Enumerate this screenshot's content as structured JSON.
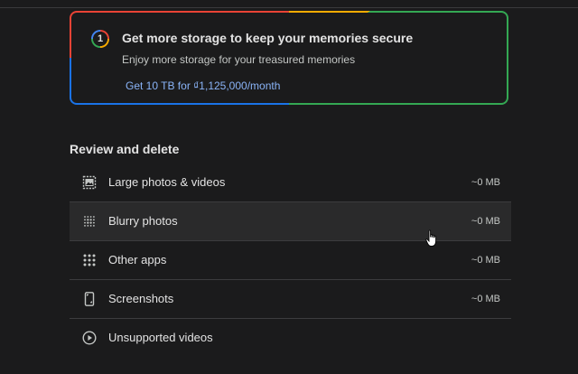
{
  "promo": {
    "icon_text": "1",
    "title": "Get more storage to keep your memories secure",
    "subtitle": "Enjoy more storage for your treasured memories",
    "link": "Get 10 TB for ₫1,125,000/month"
  },
  "review": {
    "title": "Review and delete",
    "items": [
      {
        "label": "Large photos & videos",
        "size": "~0 MB",
        "icon": "large-photo-icon"
      },
      {
        "label": "Blurry photos",
        "size": "~0 MB",
        "icon": "blurry-photo-icon"
      },
      {
        "label": "Other apps",
        "size": "~0 MB",
        "icon": "apps-grid-icon"
      },
      {
        "label": "Screenshots",
        "size": "~0 MB",
        "icon": "phone-screenshot-icon"
      },
      {
        "label": "Unsupported videos",
        "size": "",
        "icon": "play-circle-icon"
      }
    ]
  },
  "colors": {
    "background": "#1b1b1c",
    "link": "#8ab4f8",
    "hover_row": "#2a2a2b"
  }
}
